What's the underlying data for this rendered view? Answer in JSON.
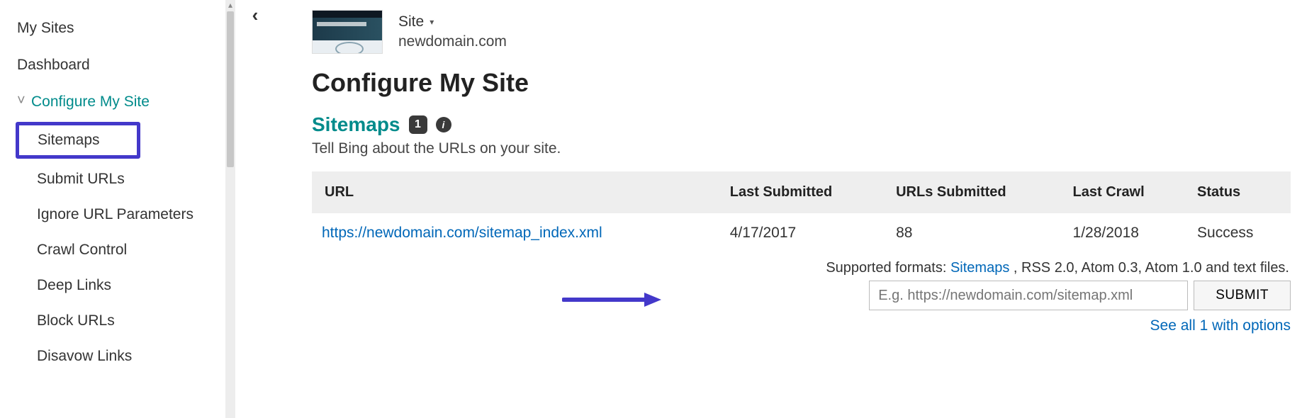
{
  "sidebar": {
    "items": [
      {
        "label": "My Sites"
      },
      {
        "label": "Dashboard"
      },
      {
        "label": "Configure My Site"
      }
    ],
    "sub": [
      {
        "label": "Sitemaps"
      },
      {
        "label": "Submit URLs"
      },
      {
        "label": "Ignore URL Parameters"
      },
      {
        "label": "Crawl Control"
      },
      {
        "label": "Deep Links"
      },
      {
        "label": "Block URLs"
      },
      {
        "label": "Disavow Links"
      }
    ]
  },
  "header": {
    "site_label": "Site",
    "domain": "newdomain.com"
  },
  "page": {
    "title": "Configure My Site",
    "section": "Sitemaps",
    "badge_count": "1",
    "desc": "Tell Bing about the URLs on your site."
  },
  "table": {
    "cols": [
      "URL",
      "Last Submitted",
      "URLs Submitted",
      "Last Crawl",
      "Status"
    ],
    "rows": [
      {
        "url": "https://newdomain.com/sitemap_index.xml",
        "last_submitted": "4/17/2017",
        "urls_submitted": "88",
        "last_crawl": "1/28/2018",
        "status": "Success"
      }
    ]
  },
  "formats": {
    "prefix": "Supported formats: ",
    "link": "Sitemaps",
    "suffix": " , RSS 2.0, Atom 0.3, Atom 1.0 and text files."
  },
  "submit": {
    "placeholder": "E.g. https://newdomain.com/sitemap.xml",
    "button": "SUBMIT"
  },
  "see_all": {
    "label": "See all 1 with options"
  }
}
